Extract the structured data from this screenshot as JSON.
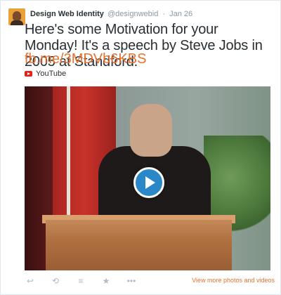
{
  "tweet": {
    "author_name": "Design Web Identity",
    "author_handle": "@designwebid",
    "separator": "·",
    "date": "Jan 26",
    "text": "Here's some Motivation for your Monday! It's a speech by Steve Jobs in 2005 at Standford.",
    "link": "fb.me/3MDVb6KBS",
    "source_label": "YouTube",
    "video_player_icon": "play-icon"
  },
  "actions": {
    "reply_icon": "↩",
    "retweet_icon": "⟲",
    "favorite_icon": "★",
    "more_icon": "•••",
    "stack_icon": "≡",
    "view_more_label": "View more photos and videos"
  },
  "colors": {
    "link": "#e8712e",
    "text": "#292f33",
    "muted": "#8899a6",
    "play": "#2a88c8",
    "youtube": "#e62117"
  }
}
